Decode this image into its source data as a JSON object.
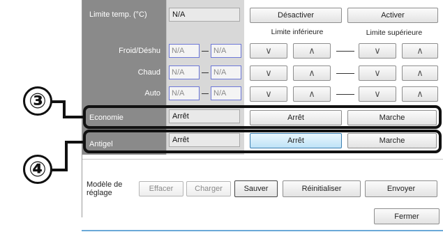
{
  "temp_limit": {
    "label": "Limite temp. (°C)",
    "value": "N/A",
    "disable_button": "Désactiver",
    "enable_button": "Activer",
    "lower_limit_header": "Limite inférieure",
    "upper_limit_header": "Limite supérieure"
  },
  "modes": [
    {
      "label": "Froid/Déshu",
      "low": "N/A",
      "high": "N/A"
    },
    {
      "label": "Chaud",
      "low": "N/A",
      "high": "N/A"
    },
    {
      "label": "Auto",
      "low": "N/A",
      "high": "N/A"
    }
  ],
  "arrows": {
    "down": "∨",
    "up": "∧"
  },
  "economie": {
    "label": "Economie",
    "value": "Arrêt",
    "off_button": "Arrêt",
    "on_button": "Marche"
  },
  "antigel": {
    "label": "Antigel",
    "value": "Arrêt",
    "off_button": "Arrêt",
    "on_button": "Marche"
  },
  "callouts": {
    "three": "③",
    "four": "④"
  },
  "preset": {
    "label_line1": "Modèle de",
    "label_line2": "réglage",
    "clear_button": "Effacer",
    "load_button": "Charger",
    "save_button": "Sauver",
    "reset_button": "Réinitialiser",
    "send_button": "Envoyer"
  },
  "close_button": "Fermer",
  "colors": {
    "label_column": "#8a8a8a",
    "highlight_border": "#111111",
    "active_button": "#bfe3f7",
    "na_field_border": "#6c77d8"
  }
}
